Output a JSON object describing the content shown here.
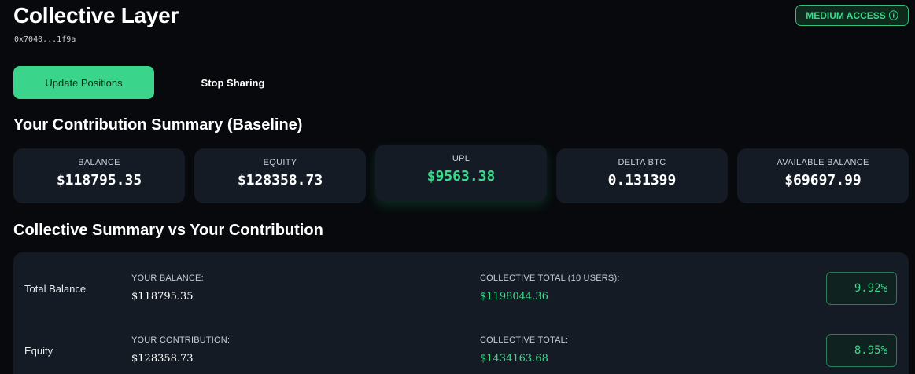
{
  "header": {
    "title": "Collective Layer",
    "address": "0x7040...1f9a",
    "access_badge": "MEDIUM ACCESS",
    "access_icon": "ⓘ"
  },
  "actions": {
    "update_label": "Update Positions",
    "stop_label": "Stop Sharing"
  },
  "contribution": {
    "title": "Your Contribution Summary (Baseline)",
    "cards": [
      {
        "label": "BALANCE",
        "value": "$118795.35"
      },
      {
        "label": "EQUITY",
        "value": "$128358.73"
      },
      {
        "label": "UPL",
        "value": "$9563.38"
      },
      {
        "label": "DELTA BTC",
        "value": "0.131399"
      },
      {
        "label": "AVAILABLE BALANCE",
        "value": "$69697.99"
      }
    ]
  },
  "collective": {
    "title": "Collective Summary vs Your Contribution",
    "rows": [
      {
        "label": "Total Balance",
        "your_label": "YOUR BALANCE:",
        "your_value": "$118795.35",
        "collective_label": "COLLECTIVE TOTAL (10 USERS):",
        "collective_value": "$1198044.36",
        "percent": "9.92%"
      },
      {
        "label": "Equity",
        "your_label": "YOUR CONTRIBUTION:",
        "your_value": "$128358.73",
        "collective_label": "COLLECTIVE TOTAL:",
        "collective_value": "$1434163.68",
        "percent": "8.95%"
      }
    ]
  },
  "colors": {
    "background": "#07090c",
    "card": "#141b24",
    "accent_green": "#3bd98c",
    "button_green": "#3ad48a"
  }
}
